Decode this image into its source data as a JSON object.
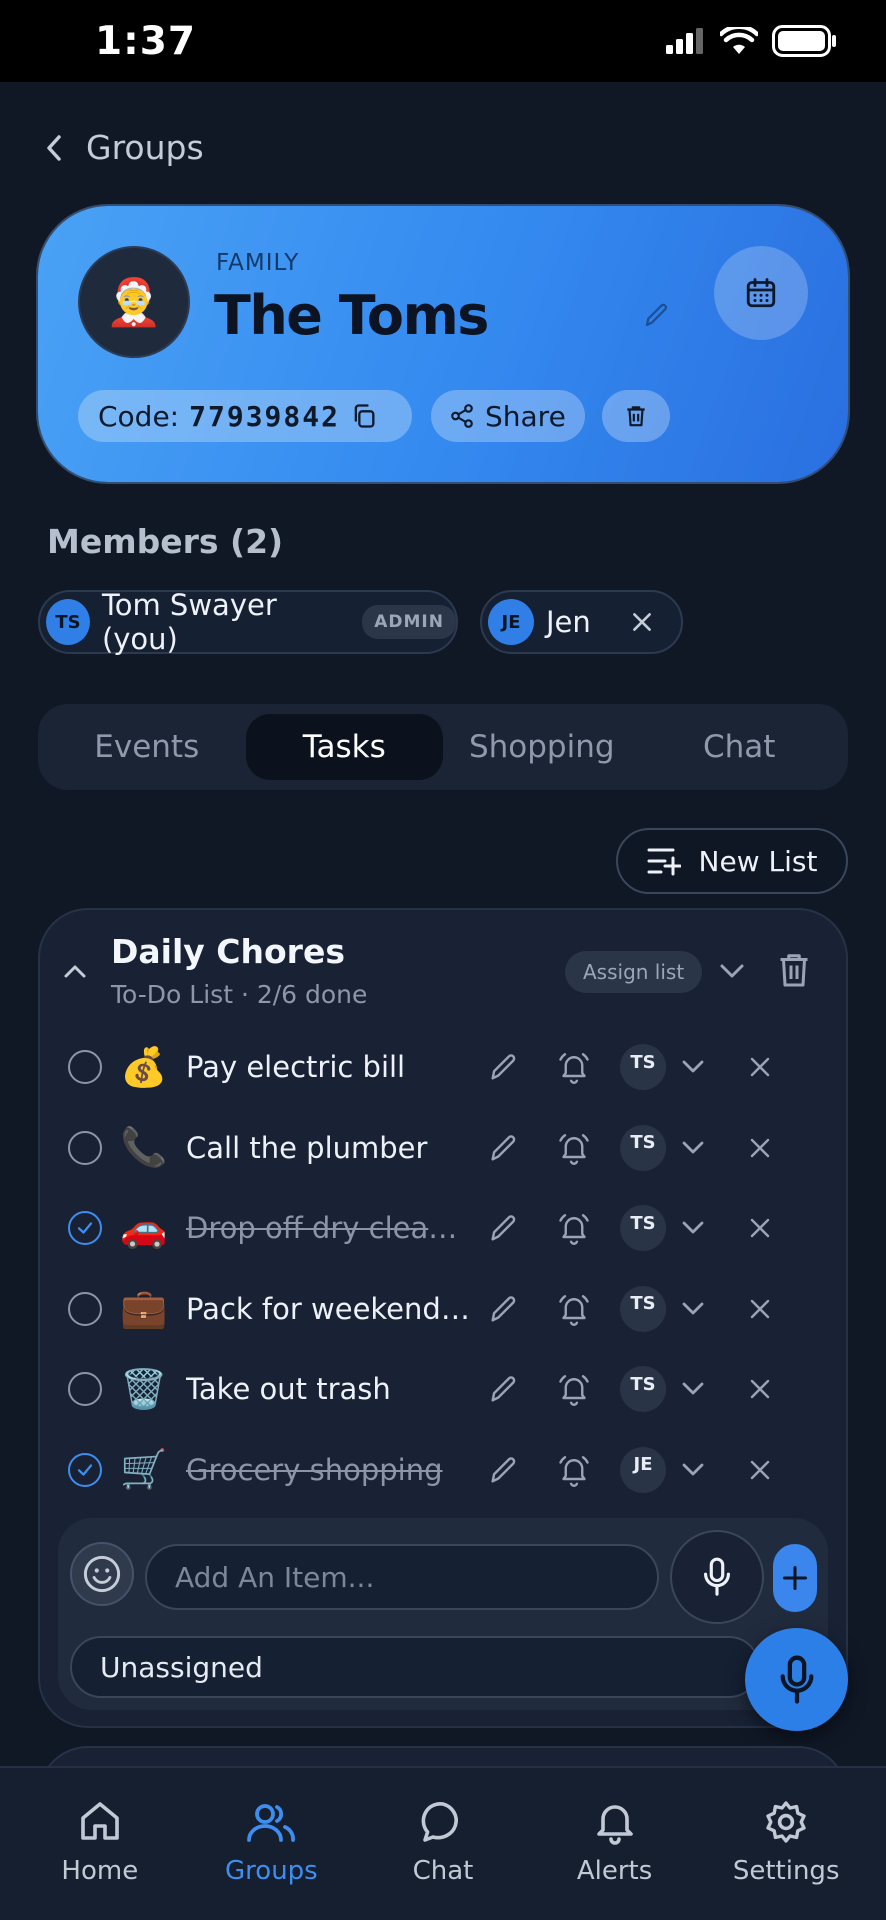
{
  "status_bar": {
    "time": "1:37"
  },
  "header": {
    "back_label": "Groups"
  },
  "group": {
    "category": "FAMILY",
    "name": "The Toms",
    "avatar_emoji": "🤶",
    "code_label": "Code:",
    "code_value": "77939842",
    "share_label": "Share"
  },
  "members": {
    "title": "Members (2)",
    "items": [
      {
        "initials": "TS",
        "name": "Tom Swayer (you)",
        "badge": "ADMIN"
      },
      {
        "initials": "JE",
        "name": "Jen"
      }
    ]
  },
  "tabs": [
    {
      "label": "Events"
    },
    {
      "label": "Tasks",
      "active": true
    },
    {
      "label": "Shopping"
    },
    {
      "label": "Chat"
    }
  ],
  "toolbar": {
    "new_list_label": "New List"
  },
  "list": {
    "title": "Daily Chores",
    "subtitle": "To-Do List · 2/6 done",
    "assign_label": "Assign list",
    "tasks": [
      {
        "emoji": "💰",
        "label": "Pay electric bill",
        "done": false,
        "assignee": "TS"
      },
      {
        "emoji": "📞",
        "label": "Call the plumber",
        "done": false,
        "assignee": "TS"
      },
      {
        "emoji": "🚗",
        "label": "Drop off dry cleaning",
        "done": true,
        "assignee": "TS"
      },
      {
        "emoji": "💼",
        "label": "Pack for weekend trip",
        "done": false,
        "assignee": "TS"
      },
      {
        "emoji": "🗑️",
        "label": "Take out trash",
        "done": false,
        "assignee": "TS"
      },
      {
        "emoji": "🛒",
        "label": "Grocery shopping",
        "done": true,
        "assignee": "JE"
      }
    ],
    "add_placeholder": "Add An Item...",
    "assignee_select": "Unassigned"
  },
  "nav": [
    {
      "label": "Home",
      "icon": "home-icon"
    },
    {
      "label": "Groups",
      "icon": "groups-icon",
      "active": true
    },
    {
      "label": "Chat",
      "icon": "chat-icon"
    },
    {
      "label": "Alerts",
      "icon": "bell-icon"
    },
    {
      "label": "Settings",
      "icon": "gear-icon"
    }
  ],
  "colors": {
    "accent": "#3d8ef0",
    "background": "#101826",
    "card": "#182234"
  }
}
